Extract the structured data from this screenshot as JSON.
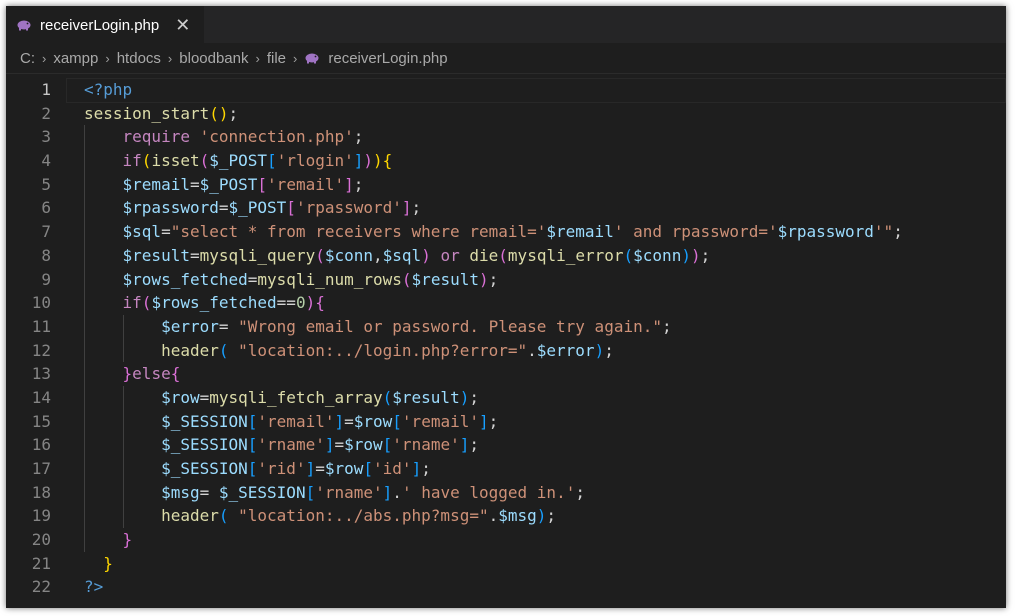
{
  "tab": {
    "title": "receiverLogin.php",
    "close_glyph": "✕",
    "icon": "php-elephant-icon"
  },
  "breadcrumb": [
    "C:",
    "xampp",
    "htdocs",
    "bloodbank",
    "file",
    "receiverLogin.php"
  ],
  "editor": {
    "active_line": 1,
    "lines": [
      [
        [
          "tag",
          "<?php"
        ]
      ],
      [
        [
          "fn",
          "session_start"
        ],
        [
          "b1",
          "()"
        ],
        [
          "def",
          ";"
        ]
      ],
      [
        [
          "def",
          "    "
        ],
        [
          "kw",
          "require"
        ],
        [
          "def",
          " "
        ],
        [
          "str",
          "'connection.php'"
        ],
        [
          "def",
          ";"
        ]
      ],
      [
        [
          "def",
          "    "
        ],
        [
          "kw",
          "if"
        ],
        [
          "b1",
          "("
        ],
        [
          "fn",
          "isset"
        ],
        [
          "b2",
          "("
        ],
        [
          "var",
          "$_POST"
        ],
        [
          "b3",
          "["
        ],
        [
          "str",
          "'rlogin'"
        ],
        [
          "b3",
          "]"
        ],
        [
          "b2",
          ")"
        ],
        [
          "b1",
          ")"
        ],
        [
          "b1",
          "{"
        ]
      ],
      [
        [
          "def",
          "    "
        ],
        [
          "var",
          "$remail"
        ],
        [
          "op",
          "="
        ],
        [
          "var",
          "$_POST"
        ],
        [
          "b2",
          "["
        ],
        [
          "str",
          "'remail'"
        ],
        [
          "b2",
          "]"
        ],
        [
          "def",
          ";"
        ]
      ],
      [
        [
          "def",
          "    "
        ],
        [
          "var",
          "$rpassword"
        ],
        [
          "op",
          "="
        ],
        [
          "var",
          "$_POST"
        ],
        [
          "b2",
          "["
        ],
        [
          "str",
          "'rpassword'"
        ],
        [
          "b2",
          "]"
        ],
        [
          "def",
          ";"
        ]
      ],
      [
        [
          "def",
          "    "
        ],
        [
          "var",
          "$sql"
        ],
        [
          "op",
          "="
        ],
        [
          "str",
          "\"select * from receivers where remail='"
        ],
        [
          "var",
          "$remail"
        ],
        [
          "str",
          "' and rpassword='"
        ],
        [
          "var",
          "$rpassword"
        ],
        [
          "str",
          "'\""
        ],
        [
          "def",
          ";"
        ]
      ],
      [
        [
          "def",
          "    "
        ],
        [
          "var",
          "$result"
        ],
        [
          "op",
          "="
        ],
        [
          "fn",
          "mysqli_query"
        ],
        [
          "b2",
          "("
        ],
        [
          "var",
          "$conn"
        ],
        [
          "def",
          ","
        ],
        [
          "var",
          "$sql"
        ],
        [
          "b2",
          ")"
        ],
        [
          "def",
          " "
        ],
        [
          "kw",
          "or"
        ],
        [
          "def",
          " "
        ],
        [
          "fn",
          "die"
        ],
        [
          "b2",
          "("
        ],
        [
          "fn",
          "mysqli_error"
        ],
        [
          "b3",
          "("
        ],
        [
          "var",
          "$conn"
        ],
        [
          "b3",
          ")"
        ],
        [
          "b2",
          ")"
        ],
        [
          "def",
          ";"
        ]
      ],
      [
        [
          "def",
          "    "
        ],
        [
          "var",
          "$rows_fetched"
        ],
        [
          "op",
          "="
        ],
        [
          "fn",
          "mysqli_num_rows"
        ],
        [
          "b2",
          "("
        ],
        [
          "var",
          "$result"
        ],
        [
          "b2",
          ")"
        ],
        [
          "def",
          ";"
        ]
      ],
      [
        [
          "def",
          "    "
        ],
        [
          "kw",
          "if"
        ],
        [
          "b2",
          "("
        ],
        [
          "var",
          "$rows_fetched"
        ],
        [
          "op",
          "=="
        ],
        [
          "num",
          "0"
        ],
        [
          "b2",
          ")"
        ],
        [
          "b2",
          "{"
        ]
      ],
      [
        [
          "def",
          "        "
        ],
        [
          "var",
          "$error"
        ],
        [
          "op",
          "="
        ],
        [
          "def",
          " "
        ],
        [
          "str",
          "\"Wrong email or password. Please try again.\""
        ],
        [
          "def",
          ";"
        ]
      ],
      [
        [
          "def",
          "        "
        ],
        [
          "fn",
          "header"
        ],
        [
          "b3",
          "("
        ],
        [
          "def",
          " "
        ],
        [
          "str",
          "\"location:../login.php?error=\""
        ],
        [
          "op",
          "."
        ],
        [
          "var",
          "$error"
        ],
        [
          "b3",
          ")"
        ],
        [
          "def",
          ";"
        ]
      ],
      [
        [
          "def",
          "    "
        ],
        [
          "b2",
          "}"
        ],
        [
          "kw",
          "else"
        ],
        [
          "b2",
          "{"
        ]
      ],
      [
        [
          "def",
          "        "
        ],
        [
          "var",
          "$row"
        ],
        [
          "op",
          "="
        ],
        [
          "fn",
          "mysqli_fetch_array"
        ],
        [
          "b3",
          "("
        ],
        [
          "var",
          "$result"
        ],
        [
          "b3",
          ")"
        ],
        [
          "def",
          ";"
        ]
      ],
      [
        [
          "def",
          "        "
        ],
        [
          "var",
          "$_SESSION"
        ],
        [
          "b3",
          "["
        ],
        [
          "str",
          "'remail'"
        ],
        [
          "b3",
          "]"
        ],
        [
          "op",
          "="
        ],
        [
          "var",
          "$row"
        ],
        [
          "b3",
          "["
        ],
        [
          "str",
          "'remail'"
        ],
        [
          "b3",
          "]"
        ],
        [
          "def",
          ";"
        ]
      ],
      [
        [
          "def",
          "        "
        ],
        [
          "var",
          "$_SESSION"
        ],
        [
          "b3",
          "["
        ],
        [
          "str",
          "'rname'"
        ],
        [
          "b3",
          "]"
        ],
        [
          "op",
          "="
        ],
        [
          "var",
          "$row"
        ],
        [
          "b3",
          "["
        ],
        [
          "str",
          "'rname'"
        ],
        [
          "b3",
          "]"
        ],
        [
          "def",
          ";"
        ]
      ],
      [
        [
          "def",
          "        "
        ],
        [
          "var",
          "$_SESSION"
        ],
        [
          "b3",
          "["
        ],
        [
          "str",
          "'rid'"
        ],
        [
          "b3",
          "]"
        ],
        [
          "op",
          "="
        ],
        [
          "var",
          "$row"
        ],
        [
          "b3",
          "["
        ],
        [
          "str",
          "'id'"
        ],
        [
          "b3",
          "]"
        ],
        [
          "def",
          ";"
        ]
      ],
      [
        [
          "def",
          "        "
        ],
        [
          "var",
          "$msg"
        ],
        [
          "op",
          "="
        ],
        [
          "def",
          " "
        ],
        [
          "var",
          "$_SESSION"
        ],
        [
          "b3",
          "["
        ],
        [
          "str",
          "'rname'"
        ],
        [
          "b3",
          "]"
        ],
        [
          "op",
          "."
        ],
        [
          "str",
          "' have logged in.'"
        ],
        [
          "def",
          ";"
        ]
      ],
      [
        [
          "def",
          "        "
        ],
        [
          "fn",
          "header"
        ],
        [
          "b3",
          "("
        ],
        [
          "def",
          " "
        ],
        [
          "str",
          "\"location:../abs.php?msg=\""
        ],
        [
          "op",
          "."
        ],
        [
          "var",
          "$msg"
        ],
        [
          "b3",
          ")"
        ],
        [
          "def",
          ";"
        ]
      ],
      [
        [
          "def",
          "    "
        ],
        [
          "b2",
          "}"
        ]
      ],
      [
        [
          "def",
          "  "
        ],
        [
          "b1",
          "}"
        ]
      ],
      [
        [
          "tag",
          "?>"
        ]
      ]
    ]
  }
}
